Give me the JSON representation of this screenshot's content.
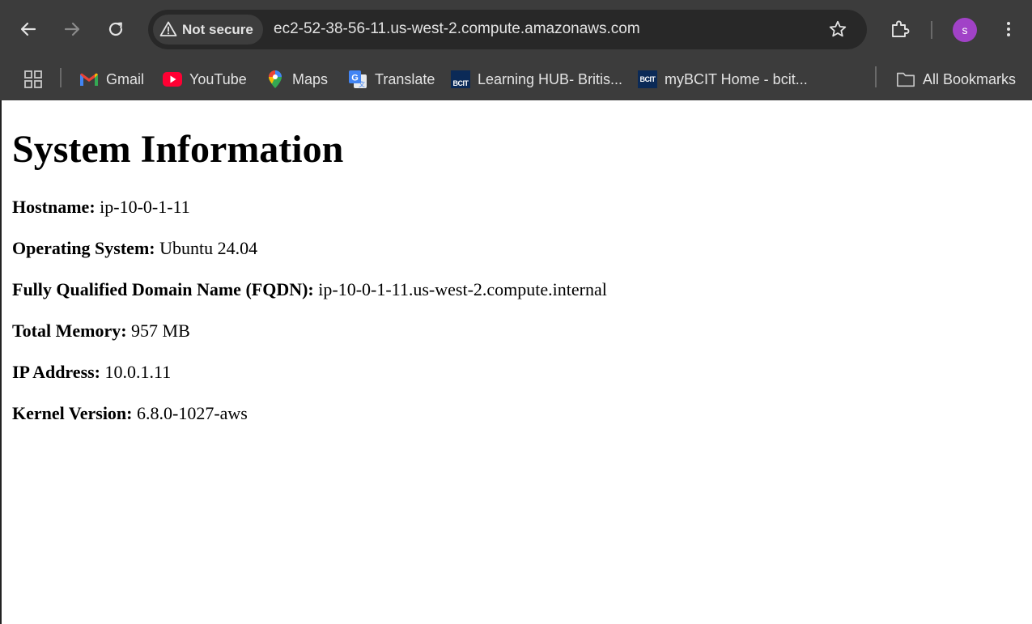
{
  "browser": {
    "toolbar": {
      "back_icon": "arrow-left",
      "forward_icon": "arrow-right",
      "reload_icon": "reload",
      "security_label": "Not secure",
      "url": "ec2-52-38-56-11.us-west-2.compute.amazonaws.com",
      "profile_initial": "s",
      "profile_color": "#a142c7"
    },
    "bookmarks": {
      "items": [
        {
          "label": "Gmail",
          "icon": "gmail-icon"
        },
        {
          "label": "YouTube",
          "icon": "youtube-icon"
        },
        {
          "label": "Maps",
          "icon": "maps-icon"
        },
        {
          "label": "Translate",
          "icon": "translate-icon"
        },
        {
          "label": "Learning HUB- Britis...",
          "icon": "bcit-icon"
        },
        {
          "label": "myBCIT Home - bcit...",
          "icon": "bcit-icon"
        }
      ],
      "all_bookmarks": "All Bookmarks"
    }
  },
  "page": {
    "title": "System Information",
    "fields": [
      {
        "label": "Hostname:",
        "value": "ip-10-0-1-11"
      },
      {
        "label": "Operating System:",
        "value": "Ubuntu 24.04"
      },
      {
        "label": "Fully Qualified Domain Name (FQDN):",
        "value": "ip-10-0-1-11.us-west-2.compute.internal"
      },
      {
        "label": "Total Memory:",
        "value": "957 MB"
      },
      {
        "label": "IP Address:",
        "value": "10.0.1.11"
      },
      {
        "label": "Kernel Version:",
        "value": "6.8.0-1027-aws"
      }
    ]
  }
}
